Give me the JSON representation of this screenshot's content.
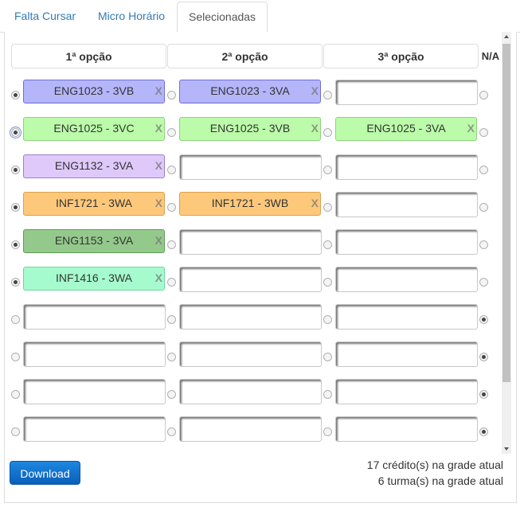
{
  "tabs": [
    {
      "label": "Falta Cursar",
      "active": false
    },
    {
      "label": "Micro Horário",
      "active": false
    },
    {
      "label": "Selecionadas",
      "active": true
    }
  ],
  "headers": {
    "opt1": "1ª opção",
    "opt2": "2ª opção",
    "opt3": "3ª opção",
    "na": "N/A"
  },
  "remove_label": "X",
  "rows": [
    {
      "selected": 1,
      "slots": [
        {
          "label": "ENG1023 - 3VB",
          "color": "#b5b5fa",
          "border": "#6d6de0"
        },
        {
          "label": "ENG1023 - 3VA",
          "color": "#b5b5fa",
          "border": "#6d6de0"
        },
        null
      ]
    },
    {
      "selected": 1,
      "focus": true,
      "slots": [
        {
          "label": "ENG1025 - 3VC",
          "color": "#bbfba9",
          "border": "#8ed27c"
        },
        {
          "label": "ENG1025 - 3VB",
          "color": "#bbfba9",
          "border": "#8ed27c"
        },
        {
          "label": "ENG1025 - 3VA",
          "color": "#bbfba9",
          "border": "#8ed27c"
        }
      ]
    },
    {
      "selected": 1,
      "slots": [
        {
          "label": "ENG1132 - 3VA",
          "color": "#dfc9fb",
          "border": "#9b7fc8"
        },
        null,
        null
      ]
    },
    {
      "selected": 1,
      "slots": [
        {
          "label": "INF1721 - 3WA",
          "color": "#fec87b",
          "border": "#d9a14f"
        },
        {
          "label": "INF1721 - 3WB",
          "color": "#fec87b",
          "border": "#d9a14f"
        },
        null
      ]
    },
    {
      "selected": 1,
      "slots": [
        {
          "label": "ENG1153 - 3VA",
          "color": "#94c98c",
          "border": "#5f9b58"
        },
        null,
        null
      ]
    },
    {
      "selected": 1,
      "slots": [
        {
          "label": "INF1416 - 3WA",
          "color": "#a6fbce",
          "border": "#6bd7a1"
        },
        null,
        null
      ]
    },
    {
      "selected": 4,
      "slots": [
        null,
        null,
        null
      ]
    },
    {
      "selected": 4,
      "slots": [
        null,
        null,
        null
      ]
    },
    {
      "selected": 4,
      "slots": [
        null,
        null,
        null
      ]
    },
    {
      "selected": 4,
      "slots": [
        null,
        null,
        null
      ]
    }
  ],
  "download_label": "Download",
  "summary": {
    "credits": "17 crédito(s) na grade atual",
    "classes": "6 turma(s) na grade atual"
  }
}
